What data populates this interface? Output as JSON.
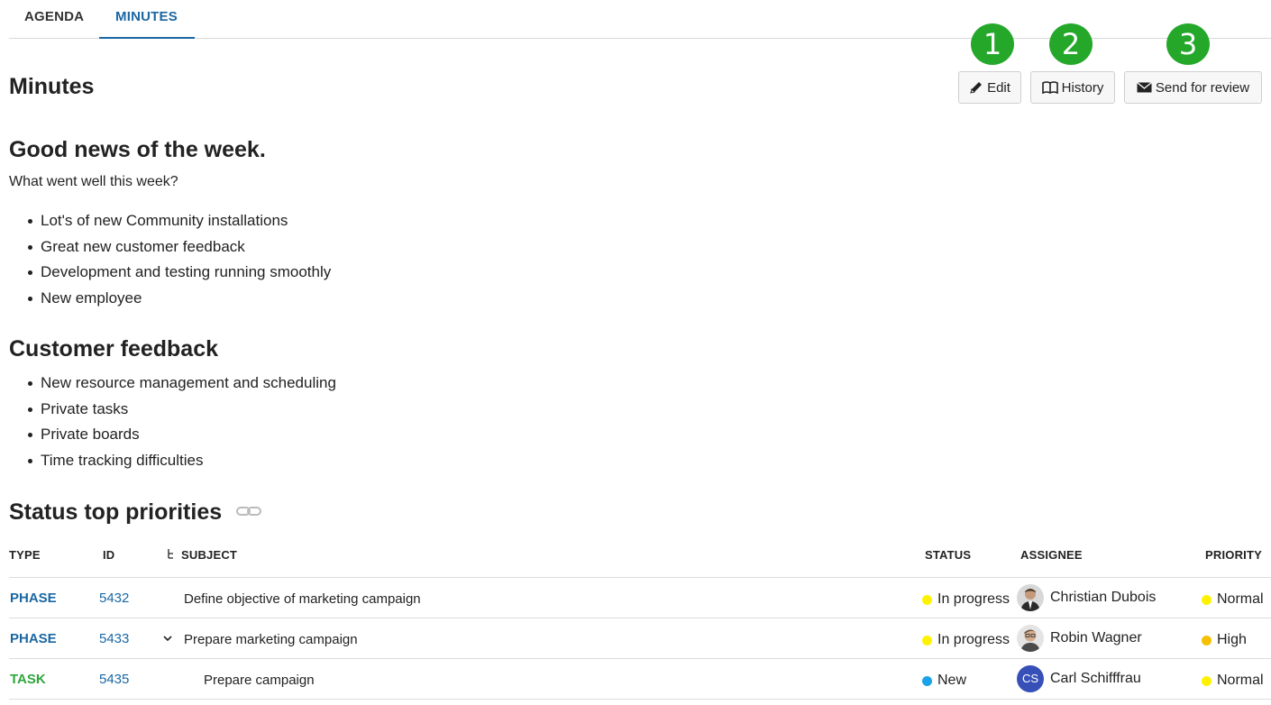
{
  "tabs": {
    "agenda": "AGENDA",
    "minutes": "MINUTES"
  },
  "badges": [
    "1",
    "2",
    "3"
  ],
  "toolbar": {
    "edit": "Edit",
    "history": "History",
    "review": "Send for review"
  },
  "page_title": "Minutes",
  "sections": {
    "good_news": {
      "heading": "Good news of the week.",
      "intro": "What went well this week?",
      "items": [
        "Lot's of new Community installations",
        "Great new customer feedback",
        "Development and testing running smoothly",
        "New employee"
      ]
    },
    "feedback": {
      "heading": "Customer feedback",
      "items": [
        "New resource management and scheduling",
        "Private tasks",
        "Private boards",
        "Time tracking difficulties"
      ]
    },
    "priorities": {
      "heading": "Status top priorities"
    }
  },
  "table": {
    "headers": {
      "type": "TYPE",
      "id": "ID",
      "subject": "SUBJECT",
      "status": "STATUS",
      "assignee": "ASSIGNEE",
      "priority": "PRIORITY"
    },
    "rows": [
      {
        "type": "PHASE",
        "id": "5432",
        "subject": "Define objective of marketing campaign",
        "status": "In progress",
        "assignee": "Christian Dubois",
        "priority": "Normal"
      },
      {
        "type": "PHASE",
        "id": "5433",
        "subject": "Prepare marketing campaign",
        "status": "In progress",
        "assignee": "Robin Wagner",
        "priority": "High"
      },
      {
        "type": "TASK",
        "id": "5435",
        "subject": "Prepare campaign",
        "status": "New",
        "assignee": "Carl Schifffrau",
        "assignee_initials": "CS",
        "priority": "Normal"
      }
    ]
  },
  "colors": {
    "accent": "#1a67a3",
    "phase": "#1a67a3",
    "task": "#2ea63b",
    "badge": "#25a82a",
    "status_in_progress": "#fff200",
    "status_new": "#1aa3e8",
    "priority_normal": "#fff200",
    "priority_high": "#f5c000",
    "avatar_cs": "#3650b8"
  },
  "icons": {
    "edit": "pencil-icon",
    "history": "book-icon",
    "review": "envelope-icon",
    "link": "link-icon",
    "expand": "chevron-down-icon",
    "hierarchy": "hierarchy-icon"
  }
}
